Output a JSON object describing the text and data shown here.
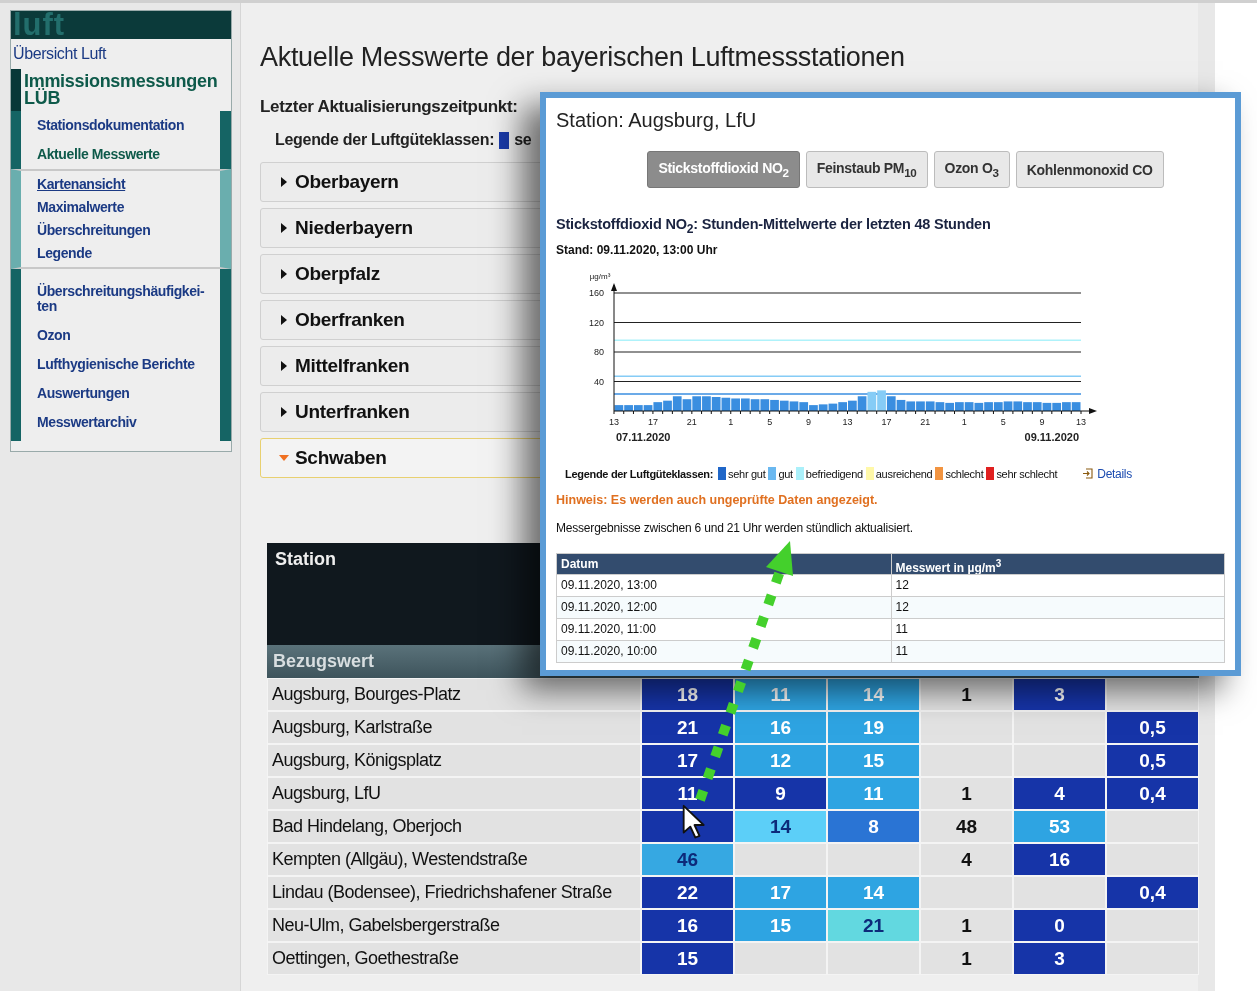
{
  "sidebar": {
    "logo": "luft",
    "items": [
      {
        "label": "Übersicht Luft"
      },
      {
        "label": "Immissionsmessungen LÜB",
        "expanded": true,
        "children": [
          {
            "label": "Stationsdokumentation",
            "selected": false
          },
          {
            "label": "Aktuelle Messwerte",
            "selected": true,
            "expanded": true,
            "children": [
              {
                "label": "Kartenansicht",
                "hovered": true
              },
              {
                "label": "Maximalwerte",
                "hovered": false
              },
              {
                "label": "Überschreitungen",
                "hovered": false
              },
              {
                "label": "Legende",
                "hovered": false
              }
            ]
          },
          {
            "label": "Überschreitungshäufigkei-ten",
            "selected": false
          },
          {
            "label": "Ozon",
            "selected": false
          },
          {
            "label": "Lufthygienische Berichte",
            "selected": false
          },
          {
            "label": "Auswertungen",
            "selected": false
          },
          {
            "label": "Messwertarchiv",
            "selected": false
          }
        ]
      }
    ]
  },
  "main": {
    "title": "Aktuelle Messwerte der bayerischen Luftmessstationen",
    "update_label": "Letzter Aktualisierungszeitpunkt:",
    "legend": {
      "label": "Legende der Luftgüteklassen:",
      "items": [
        {
          "label": "se",
          "color": "#1a3aa8"
        }
      ]
    },
    "regions": [
      {
        "label": "Oberbayern",
        "expanded": false
      },
      {
        "label": "Niederbayern",
        "expanded": false
      },
      {
        "label": "Oberpfalz",
        "expanded": false
      },
      {
        "label": "Oberfranken",
        "expanded": false
      },
      {
        "label": "Mittelfranken",
        "expanded": false
      },
      {
        "label": "Unterfranken",
        "expanded": false
      },
      {
        "label": "Schwaben",
        "expanded": true
      }
    ],
    "table": {
      "columns": [
        "Station"
      ],
      "reference_label": "Bezugswert",
      "rows": [
        {
          "station": "Augsburg, Bourges-Platz",
          "cells": [
            {
              "value": "18",
              "color": "#1634a8"
            },
            {
              "value": "11",
              "color": "#2ea4e2"
            },
            {
              "value": "14",
              "color": "#2ea4e2"
            },
            {
              "value": "1"
            },
            {
              "value": "3",
              "color": "#1634a8"
            },
            null
          ]
        },
        {
          "station": "Augsburg, Karlstraße",
          "cells": [
            {
              "value": "21",
              "color": "#1634a8"
            },
            {
              "value": "16",
              "color": "#2ea4e2"
            },
            {
              "value": "19",
              "color": "#2ea4e2"
            },
            null,
            null,
            {
              "value": "0,5",
              "color": "#1634a8"
            }
          ]
        },
        {
          "station": "Augsburg, Königsplatz",
          "cells": [
            {
              "value": "17",
              "color": "#1634a8"
            },
            {
              "value": "12",
              "color": "#2ea4e2"
            },
            {
              "value": "15",
              "color": "#2ea4e2"
            },
            null,
            null,
            {
              "value": "0,5",
              "color": "#1634a8"
            }
          ]
        },
        {
          "station": "Augsburg, LfU",
          "cells": [
            {
              "value": "11",
              "color": "#1634a8"
            },
            {
              "value": "9",
              "color": "#1634a8"
            },
            {
              "value": "11",
              "color": "#2ea4e2"
            },
            {
              "value": "1"
            },
            {
              "value": "4",
              "color": "#1634a8"
            },
            {
              "value": "0,4",
              "color": "#1634a8"
            }
          ]
        },
        {
          "station": "Bad Hindelang, Oberjoch",
          "cells": [
            {
              "color": "#1634a8"
            },
            {
              "value": "14",
              "color": "#5ccff8"
            },
            {
              "value": "8",
              "color": "#2a74d4"
            },
            {
              "value": "48"
            },
            {
              "value": "53",
              "color": "#2ea4e2"
            },
            null
          ]
        },
        {
          "station": "Kempten (Allgäu), Westendstraße",
          "cells": [
            {
              "value": "46",
              "color": "#36a8e2"
            },
            null,
            null,
            {
              "value": "4"
            },
            {
              "value": "16",
              "color": "#1634a8"
            },
            null
          ]
        },
        {
          "station": "Lindau (Bodensee), Friedrichshafener Straße",
          "cells": [
            {
              "value": "22",
              "color": "#1634a8"
            },
            {
              "value": "17",
              "color": "#2ea4e2"
            },
            {
              "value": "14",
              "color": "#2ea4e2"
            },
            null,
            null,
            {
              "value": "0,4",
              "color": "#1634a8"
            }
          ]
        },
        {
          "station": "Neu-Ulm, Gabelsbergerstraße",
          "cells": [
            {
              "value": "16",
              "color": "#1634a8"
            },
            {
              "value": "15",
              "color": "#2ea4e2"
            },
            {
              "value": "21",
              "color": "#62d8e0"
            },
            {
              "value": "1"
            },
            {
              "value": "0",
              "color": "#1634a8"
            },
            null
          ]
        },
        {
          "station": "Oettingen, Goethestraße",
          "cells": [
            {
              "value": "15",
              "color": "#1634a8"
            },
            null,
            null,
            {
              "value": "1"
            },
            {
              "value": "3",
              "color": "#1634a8"
            },
            null
          ]
        }
      ]
    }
  },
  "popup": {
    "title": "Station: Augsburg, LfU",
    "tabs": [
      {
        "label": "Stickstoffdioxid NO$_{2}$",
        "selected": true
      },
      {
        "label": "Feinstaub PM$_{10}$",
        "selected": false
      },
      {
        "label": "Ozon O$_{3}$",
        "selected": false
      },
      {
        "label": "Kohlenmonoxid CO",
        "selected": false
      }
    ],
    "heading": "Stickstoffdioxid NO$_{2}$: Stunden-Mittelwerte der letzten 48 Stunden",
    "stand": "Stand: 09.11.2020, 13:00 Uhr",
    "chart": {
      "date_labels": [
        "07.11.2020",
        "09.11.2020"
      ],
      "chart_data": {
        "type": "bar",
        "ylabel": "µg/m³",
        "ylim": [
          0,
          160
        ],
        "categories": [
          "13",
          null,
          null,
          null,
          "17",
          null,
          null,
          null,
          "21",
          null,
          null,
          null,
          "1",
          null,
          null,
          null,
          "5",
          null,
          null,
          null,
          "9",
          null,
          null,
          null,
          "13",
          null,
          null,
          null,
          "17",
          null,
          null,
          null,
          "21",
          null,
          null,
          null,
          "1",
          null,
          null,
          null,
          "5",
          null,
          null,
          null,
          "9",
          null,
          null,
          null,
          "13"
        ],
        "series": [
          {
            "color": "#3a8ee0",
            "values": [
              8,
              8,
              8,
              8,
              12,
              14,
              20,
              16,
              20,
              20,
              19,
              18,
              17,
              17,
              16,
              16,
              15,
              14,
              13,
              12,
              8,
              9,
              10,
              12,
              14,
              20,
              null,
              null,
              20,
              15,
              13,
              13,
              13,
              12,
              11,
              12,
              12,
              11,
              12,
              12,
              13,
              13,
              12,
              12,
              11,
              11,
              12,
              12,
              null
            ]
          },
          {
            "color": "#86ccf6",
            "values": [
              null,
              null,
              null,
              null,
              null,
              null,
              null,
              null,
              null,
              null,
              null,
              null,
              null,
              null,
              null,
              null,
              null,
              null,
              null,
              null,
              null,
              null,
              null,
              null,
              null,
              null,
              26,
              28,
              null,
              null,
              null,
              null,
              null,
              null,
              null,
              null,
              null,
              null,
              null,
              null,
              null,
              null,
              null,
              null,
              null,
              null,
              null,
              null,
              null
            ]
          }
        ],
        "yticks": [
          40,
          80,
          120,
          160
        ],
        "grid": true,
        "ref_lines": [
          {
            "axis": "y",
            "value": 23,
            "color": "#3a8ee0"
          },
          {
            "axis": "y",
            "value": 47,
            "color": "#86ccf6"
          },
          {
            "axis": "y",
            "value": 96,
            "color": "#aef2fa"
          }
        ]
      }
    },
    "legend": {
      "label": "Legende der Luftgüteklassen:",
      "items": [
        {
          "label": "sehr gut",
          "color": "#1f66c8"
        },
        {
          "label": "gut",
          "color": "#6ab8f0"
        },
        {
          "label": "befriedigend",
          "color": "#aaf0fa"
        },
        {
          "label": "ausreichend",
          "color": "#fff8a8"
        },
        {
          "label": "schlecht",
          "color": "#f29440"
        },
        {
          "label": "sehr schlecht",
          "color": "#e02020"
        }
      ],
      "details_link": "Details"
    },
    "notice": "Hinweis: Es werden auch ungeprüfte Daten angezeigt.",
    "message": "Messergebnisse zwischen 6 und 21 Uhr werden stündlich aktualisiert.",
    "table": {
      "columns": [
        "Datum",
        "Messwert in µg/m$^{3}$"
      ],
      "rows": [
        [
          "09.11.2020, 13:00",
          "12"
        ],
        [
          "09.11.2020, 12:00",
          "12"
        ],
        [
          "09.11.2020, 11:00",
          "11"
        ],
        [
          "09.11.2020, 10:00",
          "11"
        ]
      ]
    }
  }
}
